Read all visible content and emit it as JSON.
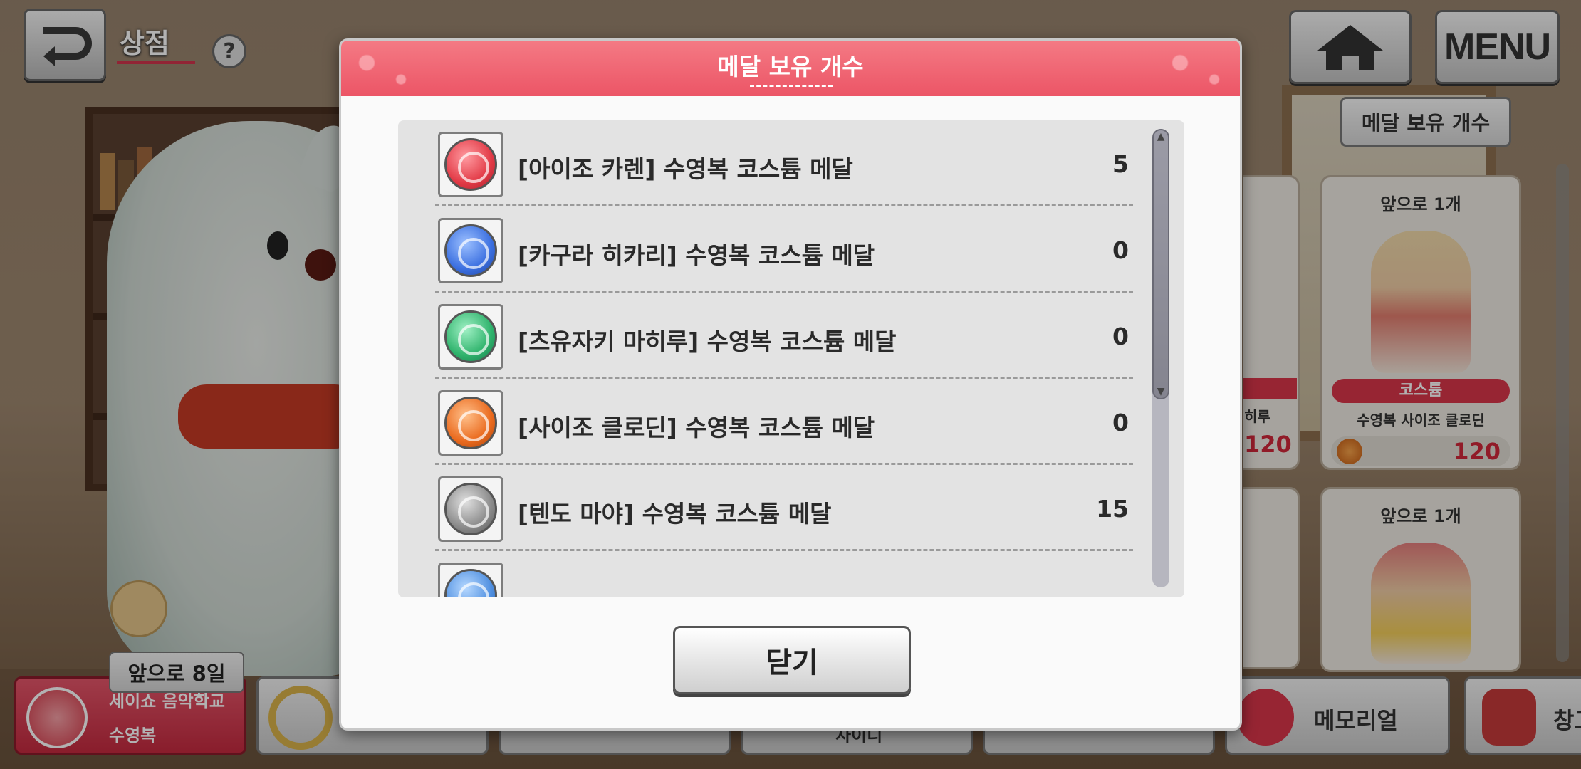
{
  "header": {
    "back_label": "",
    "shop_title": "상점",
    "help_label": "?",
    "home_label": "",
    "menu_label": "MENU",
    "medal_count_button": "메달 보유 개수"
  },
  "shop_cards": [
    {
      "until": "앞으로 1개",
      "tag": "코스튬",
      "name": "수영복 사이조 클로딘",
      "price": "120"
    },
    {
      "until": "앞으로 1개"
    }
  ],
  "partial_card": {
    "name_fragment": "히루",
    "price": "120"
  },
  "days_remaining": "앞으로 8일",
  "bottom_tabs": [
    {
      "line1": "세이쇼 음악학교",
      "line2": "수영복",
      "active": true
    },
    {
      "label": ""
    },
    {
      "label": ""
    },
    {
      "label": "사이디"
    },
    {
      "label": ""
    },
    {
      "label": "메모리얼"
    },
    {
      "label": "창고"
    }
  ],
  "modal": {
    "title": "메달 보유 개수",
    "close_label": "닫기",
    "rows": [
      {
        "name": "[아이조 카렌] 수영복 코스튬 메달",
        "count": "5",
        "color": "#e23a46"
      },
      {
        "name": "[카구라 히카리] 수영복 코스튬 메달",
        "count": "0",
        "color": "#3b6fe0"
      },
      {
        "name": "[츠유자키 마히루] 수영복 코스튬 메달",
        "count": "0",
        "color": "#2fb36c"
      },
      {
        "name": "[사이조 클로딘] 수영복 코스튬 메달",
        "count": "0",
        "color": "#ea6a1e"
      },
      {
        "name": "[텐도 마야] 수영복 코스튬 메달",
        "count": "15",
        "color": "#8a8a8a"
      }
    ],
    "partial_row_color": "#4f8fe0"
  }
}
